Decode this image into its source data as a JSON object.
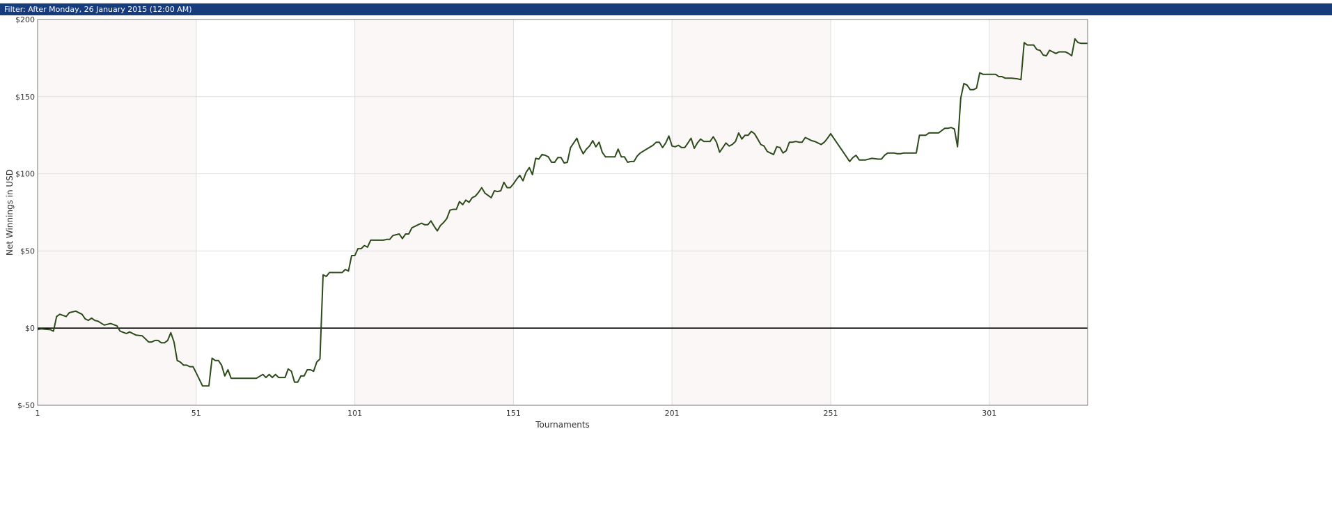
{
  "filter_bar": {
    "prefix": "Filter:",
    "text": "After Monday, 26 January 2015 (12:00 AM)"
  },
  "colors": {
    "filter_bar_bg": "#163c7e",
    "band_shaded": "#fcf7f7",
    "band_plain": "#ffffff",
    "series_line": "#2c4a1a",
    "zero_line": "#000000",
    "grid": "#dddddd"
  },
  "chart_data": {
    "type": "line",
    "title": "",
    "xlabel": "Tournaments",
    "ylabel": "Net Winnings in USD",
    "xlim": [
      1,
      332
    ],
    "ylim": [
      -50,
      200
    ],
    "x_ticks": [
      1,
      51,
      101,
      151,
      201,
      251,
      301
    ],
    "y_ticks": [
      -50,
      0,
      50,
      100,
      150,
      200
    ],
    "y_tick_labels": [
      "$-50",
      "$0",
      "$50",
      "$100",
      "$150",
      "$200"
    ],
    "grid": true,
    "shaded_bands": [
      [
        1,
        51
      ],
      [
        101,
        151
      ],
      [
        201,
        251
      ],
      [
        301,
        332
      ]
    ],
    "zero_line": true,
    "series": [
      {
        "points": [
          [
            1,
            -1
          ],
          [
            2,
            -0.5
          ],
          [
            5,
            -1
          ],
          [
            6,
            -2
          ],
          [
            7,
            7.5
          ],
          [
            8,
            9
          ],
          [
            10,
            7.5
          ],
          [
            11,
            10
          ],
          [
            13,
            11
          ],
          [
            15,
            9
          ],
          [
            16,
            6
          ],
          [
            17,
            5
          ],
          [
            18,
            6.5
          ],
          [
            19,
            5
          ],
          [
            20,
            4.5
          ],
          [
            22,
            2
          ],
          [
            24,
            3
          ],
          [
            26,
            1.5
          ],
          [
            27,
            -2
          ],
          [
            29,
            -3.5
          ],
          [
            30,
            -2.5
          ],
          [
            32,
            -4.5
          ],
          [
            34,
            -5
          ],
          [
            35,
            -7
          ],
          [
            36,
            -9
          ],
          [
            37,
            -9
          ],
          [
            38,
            -8
          ],
          [
            39,
            -8
          ],
          [
            40,
            -9.5
          ],
          [
            41,
            -9.5
          ],
          [
            42,
            -8
          ],
          [
            43,
            -3
          ],
          [
            44,
            -9
          ],
          [
            45,
            -21
          ],
          [
            46,
            -22
          ],
          [
            47,
            -24
          ],
          [
            48,
            -24
          ],
          [
            49,
            -25
          ],
          [
            50,
            -25
          ],
          [
            51,
            -29
          ],
          [
            53,
            -37.5
          ],
          [
            55,
            -37.5
          ],
          [
            56,
            -19.5
          ],
          [
            57,
            -21
          ],
          [
            58,
            -21
          ],
          [
            59,
            -24
          ],
          [
            60,
            -31
          ],
          [
            61,
            -27
          ],
          [
            62,
            -32.5
          ],
          [
            64,
            -32.5
          ],
          [
            66,
            -32.5
          ],
          [
            68,
            -32.5
          ],
          [
            70,
            -32.5
          ],
          [
            72,
            -30
          ],
          [
            73,
            -32
          ],
          [
            74,
            -30
          ],
          [
            75,
            -32
          ],
          [
            76,
            -30
          ],
          [
            77,
            -32
          ],
          [
            78,
            -32
          ],
          [
            79,
            -32
          ],
          [
            80,
            -26.5
          ],
          [
            81,
            -28
          ],
          [
            82,
            -35
          ],
          [
            83,
            -35
          ],
          [
            84,
            -31
          ],
          [
            85,
            -31
          ],
          [
            86,
            -27
          ],
          [
            87,
            -27
          ],
          [
            88,
            -28
          ],
          [
            89,
            -22
          ],
          [
            90,
            -20
          ],
          [
            91,
            34.5
          ],
          [
            92,
            33.5
          ],
          [
            93,
            36
          ],
          [
            95,
            36
          ],
          [
            96,
            36
          ],
          [
            97,
            36
          ],
          [
            98,
            38
          ],
          [
            99,
            37
          ],
          [
            100,
            47
          ],
          [
            101,
            47
          ],
          [
            102,
            51.5
          ],
          [
            103,
            51.5
          ],
          [
            104,
            53.5
          ],
          [
            105,
            52.5
          ],
          [
            106,
            57
          ],
          [
            108,
            57
          ],
          [
            110,
            57
          ],
          [
            111,
            57.5
          ],
          [
            112,
            57.5
          ],
          [
            113,
            60
          ],
          [
            115,
            61
          ],
          [
            116,
            58
          ],
          [
            117,
            61
          ],
          [
            118,
            61
          ],
          [
            119,
            65
          ],
          [
            120,
            66
          ],
          [
            121,
            67
          ],
          [
            122,
            68
          ],
          [
            123,
            67
          ],
          [
            124,
            67
          ],
          [
            125,
            69.5
          ],
          [
            126,
            66
          ],
          [
            127,
            63
          ],
          [
            128,
            66.5
          ],
          [
            129,
            68.5
          ],
          [
            130,
            71
          ],
          [
            131,
            76.5
          ],
          [
            132,
            77
          ],
          [
            133,
            77
          ],
          [
            134,
            82
          ],
          [
            135,
            80
          ],
          [
            136,
            83
          ],
          [
            137,
            81.5
          ],
          [
            138,
            84.5
          ],
          [
            139,
            85.5
          ],
          [
            140,
            88
          ],
          [
            141,
            91
          ],
          [
            142,
            87.5
          ],
          [
            143,
            86
          ],
          [
            144,
            84.5
          ],
          [
            145,
            89
          ],
          [
            146,
            88.5
          ],
          [
            147,
            89
          ],
          [
            148,
            94.5
          ],
          [
            149,
            91
          ],
          [
            150,
            91
          ],
          [
            151,
            93.5
          ],
          [
            152,
            96.5
          ],
          [
            153,
            99
          ],
          [
            154,
            95.5
          ],
          [
            155,
            101
          ],
          [
            156,
            104
          ],
          [
            157,
            99.5
          ],
          [
            158,
            110
          ],
          [
            159,
            109.5
          ],
          [
            160,
            112.5
          ],
          [
            161,
            112
          ],
          [
            162,
            111
          ],
          [
            163,
            107.5
          ],
          [
            164,
            107.5
          ],
          [
            165,
            110.5
          ],
          [
            166,
            110.5
          ],
          [
            167,
            107
          ],
          [
            168,
            107.5
          ],
          [
            169,
            117
          ],
          [
            170,
            120
          ],
          [
            171,
            123
          ],
          [
            172,
            117
          ],
          [
            173,
            113
          ],
          [
            174,
            116
          ],
          [
            175,
            118
          ],
          [
            176,
            121.5
          ],
          [
            177,
            117.5
          ],
          [
            178,
            120.5
          ],
          [
            179,
            114
          ],
          [
            180,
            111
          ],
          [
            182,
            111
          ],
          [
            183,
            111
          ],
          [
            184,
            116
          ],
          [
            185,
            111
          ],
          [
            186,
            111
          ],
          [
            187,
            107.5
          ],
          [
            188,
            108
          ],
          [
            189,
            108
          ],
          [
            190,
            111.5
          ],
          [
            191,
            113.5
          ],
          [
            193,
            116
          ],
          [
            195,
            118.5
          ],
          [
            196,
            120.5
          ],
          [
            197,
            120.5
          ],
          [
            198,
            117
          ],
          [
            199,
            120
          ],
          [
            200,
            124.5
          ],
          [
            201,
            118
          ],
          [
            202,
            117.5
          ],
          [
            203,
            118.5
          ],
          [
            204,
            117
          ],
          [
            205,
            117
          ],
          [
            206,
            120
          ],
          [
            207,
            123
          ],
          [
            208,
            116.5
          ],
          [
            209,
            120
          ],
          [
            210,
            122.5
          ],
          [
            211,
            121
          ],
          [
            212,
            121
          ],
          [
            213,
            121
          ],
          [
            214,
            124
          ],
          [
            215,
            120.5
          ],
          [
            216,
            114
          ],
          [
            217,
            117
          ],
          [
            218,
            120
          ],
          [
            219,
            118
          ],
          [
            220,
            119
          ],
          [
            221,
            121
          ],
          [
            222,
            126.5
          ],
          [
            223,
            122.5
          ],
          [
            224,
            125
          ],
          [
            225,
            125
          ],
          [
            226,
            127.5
          ],
          [
            227,
            126
          ],
          [
            228,
            122.5
          ],
          [
            229,
            119
          ],
          [
            230,
            118
          ],
          [
            231,
            114.5
          ],
          [
            232,
            113.5
          ],
          [
            233,
            112.5
          ],
          [
            234,
            117.5
          ],
          [
            235,
            117
          ],
          [
            236,
            113.5
          ],
          [
            237,
            115
          ],
          [
            238,
            120.5
          ],
          [
            239,
            120.5
          ],
          [
            240,
            121
          ],
          [
            241,
            120.5
          ],
          [
            242,
            120.5
          ],
          [
            243,
            123.5
          ],
          [
            244,
            122.5
          ],
          [
            245,
            121.5
          ],
          [
            246,
            121
          ],
          [
            247,
            120
          ],
          [
            248,
            119
          ],
          [
            249,
            120.5
          ],
          [
            250,
            123
          ],
          [
            251,
            126
          ],
          [
            253,
            120
          ],
          [
            255,
            114
          ],
          [
            257,
            108
          ],
          [
            258,
            110.5
          ],
          [
            259,
            112
          ],
          [
            260,
            109
          ],
          [
            262,
            109
          ],
          [
            264,
            110
          ],
          [
            266,
            109.5
          ],
          [
            267,
            109.5
          ],
          [
            268,
            112
          ],
          [
            269,
            113.5
          ],
          [
            270,
            113.5
          ],
          [
            271,
            113.5
          ],
          [
            272,
            113
          ],
          [
            273,
            113
          ],
          [
            274,
            113.5
          ],
          [
            276,
            113.5
          ],
          [
            277,
            113.5
          ],
          [
            278,
            113.5
          ],
          [
            279,
            125
          ],
          [
            281,
            125
          ],
          [
            282,
            126.5
          ],
          [
            284,
            126.5
          ],
          [
            285,
            126.5
          ],
          [
            286,
            128
          ],
          [
            287,
            129.5
          ],
          [
            288,
            129.5
          ],
          [
            289,
            130
          ],
          [
            290,
            129
          ],
          [
            291,
            117.5
          ],
          [
            292,
            149
          ],
          [
            293,
            158.5
          ],
          [
            294,
            157.5
          ],
          [
            295,
            154.5
          ],
          [
            296,
            154.5
          ],
          [
            297,
            155.5
          ],
          [
            298,
            165.5
          ],
          [
            299,
            164.5
          ],
          [
            301,
            164.5
          ],
          [
            303,
            164.5
          ],
          [
            304,
            163
          ],
          [
            305,
            163
          ],
          [
            306,
            162
          ],
          [
            308,
            162
          ],
          [
            310,
            161.5
          ],
          [
            311,
            161
          ],
          [
            312,
            185
          ],
          [
            313,
            183.5
          ],
          [
            315,
            183.5
          ],
          [
            316,
            180.5
          ],
          [
            317,
            180
          ],
          [
            318,
            177
          ],
          [
            319,
            176.5
          ],
          [
            320,
            180
          ],
          [
            321,
            179
          ],
          [
            322,
            178
          ],
          [
            323,
            179
          ],
          [
            325,
            179
          ],
          [
            326,
            178
          ],
          [
            327,
            176.5
          ],
          [
            328,
            187.5
          ],
          [
            329,
            185
          ],
          [
            330,
            184.5
          ],
          [
            332,
            184.5
          ]
        ]
      }
    ]
  }
}
